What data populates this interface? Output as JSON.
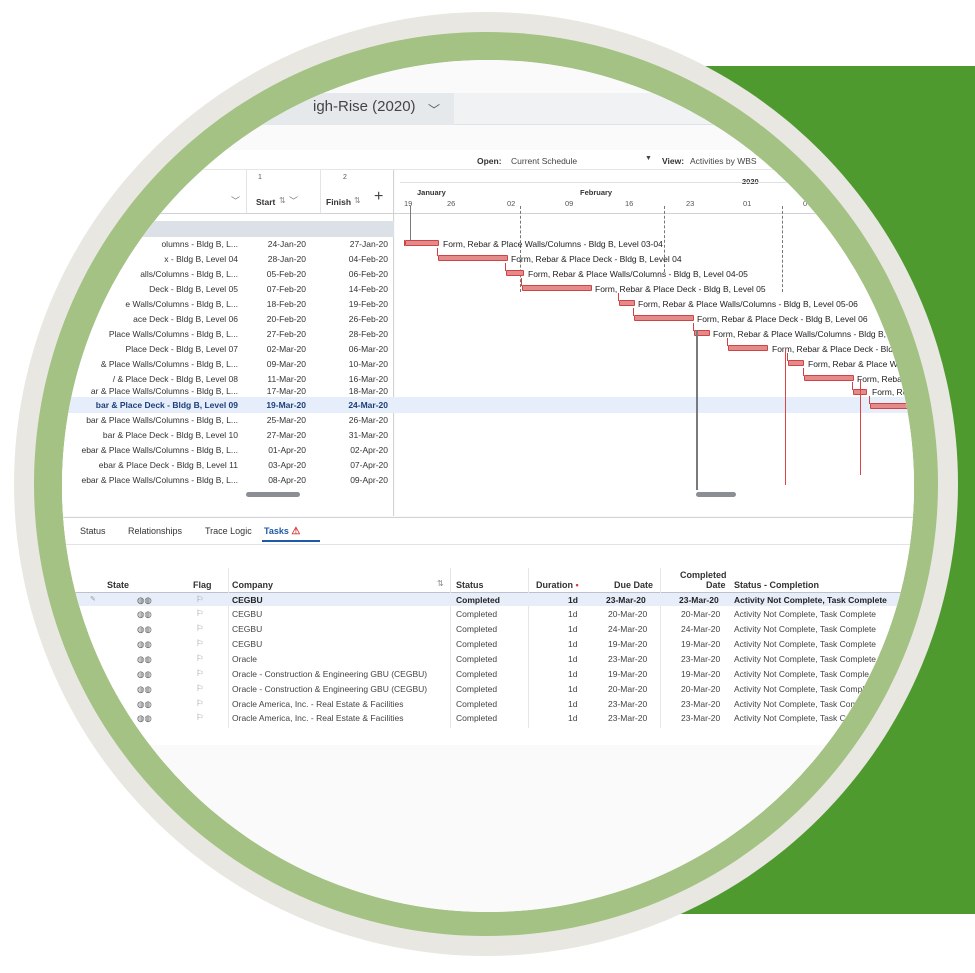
{
  "project": {
    "title": "igh-Rise (2020)",
    "chevron": "﹀"
  },
  "toolbar": {
    "open_label": "Open:",
    "open_value": "Current Schedule",
    "view_label": "View:",
    "view_value": "Activities by WBS"
  },
  "columns": {
    "start_num": "1",
    "finish_num": "2",
    "start": "Start",
    "finish": "Finish",
    "add": "+"
  },
  "timeline": {
    "year": "2020",
    "months": [
      "January",
      "February"
    ],
    "days": [
      "19",
      "26",
      "02",
      "09",
      "16",
      "23",
      "01",
      "0"
    ]
  },
  "activities": [
    {
      "name": "olumns - Bldg B, L...",
      "start": "24-Jan-20",
      "finish": "27-Jan-20",
      "bar_label": "Form, Rebar & Place Walls/Columns - Bldg B, Level 03-04"
    },
    {
      "name": "x - Bldg B, Level 04",
      "start": "28-Jan-20",
      "finish": "04-Feb-20",
      "bar_label": "Form, Rebar & Place Deck - Bldg B, Level 04"
    },
    {
      "name": "alls/Columns - Bldg B, L...",
      "start": "05-Feb-20",
      "finish": "06-Feb-20",
      "bar_label": "Form, Rebar & Place Walls/Columns - Bldg B, Level 04-05"
    },
    {
      "name": "Deck - Bldg B, Level 05",
      "start": "07-Feb-20",
      "finish": "14-Feb-20",
      "bar_label": "Form, Rebar & Place Deck - Bldg B, Level 05"
    },
    {
      "name": "e Walls/Columns - Bldg B, L...",
      "start": "18-Feb-20",
      "finish": "19-Feb-20",
      "bar_label": "Form, Rebar & Place Walls/Columns - Bldg B, Level 05-06"
    },
    {
      "name": "ace Deck - Bldg B, Level 06",
      "start": "20-Feb-20",
      "finish": "26-Feb-20",
      "bar_label": "Form, Rebar & Place Deck - Bldg B, Level 06"
    },
    {
      "name": "Place Walls/Columns - Bldg B, L...",
      "start": "27-Feb-20",
      "finish": "28-Feb-20",
      "bar_label": "Form, Rebar & Place Walls/Columns - Bldg B,"
    },
    {
      "name": "Place Deck - Bldg B, Level 07",
      "start": "02-Mar-20",
      "finish": "06-Mar-20",
      "bar_label": "Form, Rebar & Place Deck - Bld"
    },
    {
      "name": "& Place Walls/Columns - Bldg B, L...",
      "start": "09-Mar-20",
      "finish": "10-Mar-20",
      "bar_label": "Form, Rebar & Place Wa"
    },
    {
      "name": "/ & Place Deck - Bldg B, Level 08",
      "start": "11-Mar-20",
      "finish": "16-Mar-20",
      "bar_label": "Form, Rebar"
    },
    {
      "name": "ar & Place Walls/Columns - Bldg B, L...",
      "start": "17-Mar-20",
      "finish": "18-Mar-20",
      "bar_label": "Form, Re"
    },
    {
      "name": "bar & Place Deck - Bldg B, Level 09",
      "start": "19-Mar-20",
      "finish": "24-Mar-20",
      "bar_label": ""
    },
    {
      "name": "bar & Place Walls/Columns - Bldg B, L...",
      "start": "25-Mar-20",
      "finish": "26-Mar-20",
      "bar_label": ""
    },
    {
      "name": "bar & Place Deck - Bldg B, Level 10",
      "start": "27-Mar-20",
      "finish": "31-Mar-20",
      "bar_label": ""
    },
    {
      "name": "ebar & Place Walls/Columns - Bldg B, L...",
      "start": "01-Apr-20",
      "finish": "02-Apr-20",
      "bar_label": ""
    },
    {
      "name": "ebar & Place Deck - Bldg B, Level 11",
      "start": "03-Apr-20",
      "finish": "07-Apr-20",
      "bar_label": ""
    },
    {
      "name": "ebar & Place Walls/Columns - Bldg B, L...",
      "start": "08-Apr-20",
      "finish": "09-Apr-20",
      "bar_label": ""
    }
  ],
  "tabs": [
    "Status",
    "Relationships",
    "Trace Logic",
    "Tasks"
  ],
  "task_columns": {
    "state": "State",
    "flag": "Flag",
    "company": "Company",
    "status": "Status",
    "duration": "Duration",
    "required": "•",
    "due": "Due Date",
    "completed": "Completed",
    "completed2": "Date",
    "status_completion": "Status - Completion"
  },
  "tasks": [
    {
      "company": "CEGBU",
      "status": "Completed",
      "duration": "1d",
      "due": "23-Mar-20",
      "completed": "23-Mar-20",
      "completion": "Activity Not Complete, Task Complete"
    },
    {
      "company": "CEGBU",
      "status": "Completed",
      "duration": "1d",
      "due": "20-Mar-20",
      "completed": "20-Mar-20",
      "completion": "Activity Not Complete, Task Complete"
    },
    {
      "company": "CEGBU",
      "status": "Completed",
      "duration": "1d",
      "due": "24-Mar-20",
      "completed": "24-Mar-20",
      "completion": "Activity Not Complete, Task Complete"
    },
    {
      "company": "CEGBU",
      "status": "Completed",
      "duration": "1d",
      "due": "19-Mar-20",
      "completed": "19-Mar-20",
      "completion": "Activity Not Complete, Task Complete"
    },
    {
      "company": "Oracle",
      "status": "Completed",
      "duration": "1d",
      "due": "23-Mar-20",
      "completed": "23-Mar-20",
      "completion": "Activity Not Complete, Task Complete"
    },
    {
      "company": "Oracle - Construction & Engineering GBU (CEGBU)",
      "status": "Completed",
      "duration": "1d",
      "due": "19-Mar-20",
      "completed": "19-Mar-20",
      "completion": "Activity Not Complete, Task Comple"
    },
    {
      "company": "Oracle - Construction & Engineering GBU (CEGBU)",
      "status": "Completed",
      "duration": "1d",
      "due": "20-Mar-20",
      "completed": "20-Mar-20",
      "completion": "Activity Not Complete, Task Compl"
    },
    {
      "company": "Oracle America, Inc. - Real Estate & Facilities",
      "status": "Completed",
      "duration": "1d",
      "due": "23-Mar-20",
      "completed": "23-Mar-20",
      "completion": "Activity Not Complete, Task Com"
    },
    {
      "company": "Oracle America, Inc. - Real Estate & Facilities",
      "status": "Completed",
      "duration": "1d",
      "due": "23-Mar-20",
      "completed": "23-Mar-20",
      "completion": "Activity Not Complete, Task Co"
    }
  ],
  "colors": {
    "brand_green": "#4f9a2f",
    "ring_light_green": "#a3c283",
    "ring_beige": "#e8e7e1",
    "gantt_bar": "#e58a8a",
    "selection": "#e6eefb",
    "accent_blue": "#1e5aa8"
  }
}
